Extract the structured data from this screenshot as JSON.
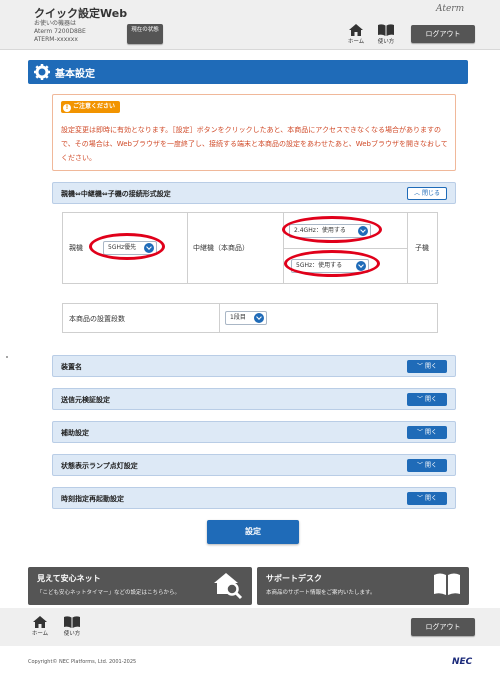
{
  "header": {
    "app_title": "クイック設定Web",
    "device_label": "お使いの機器は",
    "device_model": "Aterm 7200D8BE",
    "device_name": "ATERM-xxxxxx",
    "status_button": "現在の状態",
    "home_label": "ホーム",
    "help_label": "使い方",
    "logout_label": "ログアウト",
    "brand": "Aterm"
  },
  "section": {
    "title": "基本設定"
  },
  "notice": {
    "badge": "ご注意ください",
    "text": "設定変更は即時に有効となります。［設定］ボタンをクリックしたあと、本商品にアクセスできなくなる場合がありますので、その場合は、Webブラウザを一度終了し、接続する端末と本商品の設定をあわせたあと、Webブラウザを開きなおしてください。"
  },
  "connection_panel": {
    "title": "親機⇔中継機⇔子機の接続形式設定",
    "toggle_label": "閉じる",
    "parent_label": "親機",
    "parent_value": "5GHz優先",
    "repeater_label": "中継機（本商品）",
    "repeater_value_24": "2.4GHz：使用する",
    "repeater_value_5": "5GHz：使用する",
    "child_label": "子機"
  },
  "stage": {
    "label": "本商品の設置段数",
    "value": "1段目"
  },
  "panels": [
    {
      "title": "装置名",
      "toggle": "開く"
    },
    {
      "title": "送信元検証設定",
      "toggle": "開く"
    },
    {
      "title": "補助設定",
      "toggle": "開く"
    },
    {
      "title": "状態表示ランプ点灯設定",
      "toggle": "開く"
    },
    {
      "title": "時刻指定再起動設定",
      "toggle": "開く"
    }
  ],
  "set_button": "設定",
  "banners": {
    "safety_title": "見えて安心ネット",
    "safety_sub": "「こども安心ネットタイマー」などの設定はこちらから。",
    "support_title": "サポートデスク",
    "support_sub": "本商品のサポート情報をご案内いたします。"
  },
  "footer": {
    "home_label": "ホーム",
    "help_label": "使い方",
    "logout_label": "ログアウト",
    "copyright": "Copyright© NEC Platforms, Ltd. 2001-2025",
    "nec": "NEC"
  },
  "colors": {
    "accent": "#1f6bb8",
    "notice_text": "#d04a28",
    "badge": "#f29400",
    "highlight_ring": "#e0001a",
    "dark_button": "#555555"
  }
}
